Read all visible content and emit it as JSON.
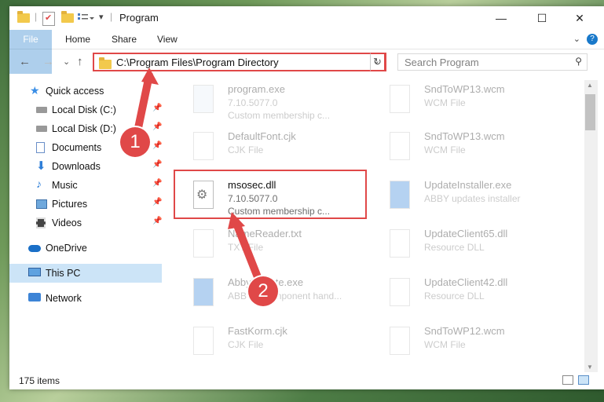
{
  "window": {
    "title": "Program",
    "minimize": "—",
    "maximize": "☐",
    "close": "✕"
  },
  "ribbon": {
    "tabs": [
      "File",
      "Home",
      "Share",
      "View"
    ],
    "help": "?"
  },
  "nav": {
    "back": "←",
    "forward": "→",
    "recent": "⌄",
    "up": "↑",
    "address": "C:\\Program Files\\Program Directory",
    "address_chevron": "⌄",
    "refresh": "↻",
    "search_placeholder": "Search Program",
    "search_icon": "⚲"
  },
  "sidebar": {
    "items": [
      {
        "label": "Quick access",
        "icon": "star-icon",
        "pinned": false
      },
      {
        "label": "Local Disk (C:)",
        "icon": "drive-icon",
        "pinned": true
      },
      {
        "label": "Local Disk (D:)",
        "icon": "drive-icon",
        "pinned": true
      },
      {
        "label": "Documents",
        "icon": "documents-icon",
        "pinned": true
      },
      {
        "label": "Downloads",
        "icon": "download-icon",
        "pinned": true
      },
      {
        "label": "Music",
        "icon": "music-icon",
        "pinned": true
      },
      {
        "label": "Pictures",
        "icon": "pictures-icon",
        "pinned": true
      },
      {
        "label": "Videos",
        "icon": "videos-icon",
        "pinned": true
      },
      {
        "label": "OneDrive",
        "icon": "cloud-icon",
        "pinned": false
      },
      {
        "label": "This PC",
        "icon": "pc-icon",
        "pinned": false,
        "selected": true
      },
      {
        "label": "Network",
        "icon": "network-icon",
        "pinned": false
      }
    ],
    "pin_glyph": "📌"
  },
  "files": [
    {
      "name": "program.exe",
      "line1": "7.10.5077.0",
      "line2": "Custom membership c..."
    },
    {
      "name": "SndToWP13.wcm",
      "line1": "WCM File",
      "line2": ""
    },
    {
      "name": "DefaultFont.cjk",
      "line1": "CJK File",
      "line2": ""
    },
    {
      "name": "SndToWP13.wcm",
      "line1": "WCM File",
      "line2": ""
    },
    {
      "name": "msosec.dll",
      "line1": "7.10.5077.0",
      "line2": "Custom membership c...",
      "highlight": true
    },
    {
      "name": "UpdateInstaller.exe",
      "line1": "ABBY updates installer",
      "line2": ""
    },
    {
      "name": "NameReader.txt",
      "line1": "TXT File",
      "line2": ""
    },
    {
      "name": "UpdateClient65.dll",
      "line1": "Resource DLL",
      "line2": ""
    },
    {
      "name": "AbbyUpdate.exe",
      "line1": "ABBYY Component hand...",
      "line2": ""
    },
    {
      "name": "UpdateClient42.dll",
      "line1": "Resource DLL",
      "line2": ""
    },
    {
      "name": "FastKorm.cjk",
      "line1": "CJK File",
      "line2": ""
    },
    {
      "name": "SndToWP12.wcm",
      "line1": "WCM File",
      "line2": ""
    }
  ],
  "status": {
    "count": "175 items"
  },
  "callouts": [
    "1",
    "2"
  ],
  "colors": {
    "accent": "#1979ca",
    "highlight_red": "#e04848",
    "selected_bg": "#cce4f7"
  }
}
